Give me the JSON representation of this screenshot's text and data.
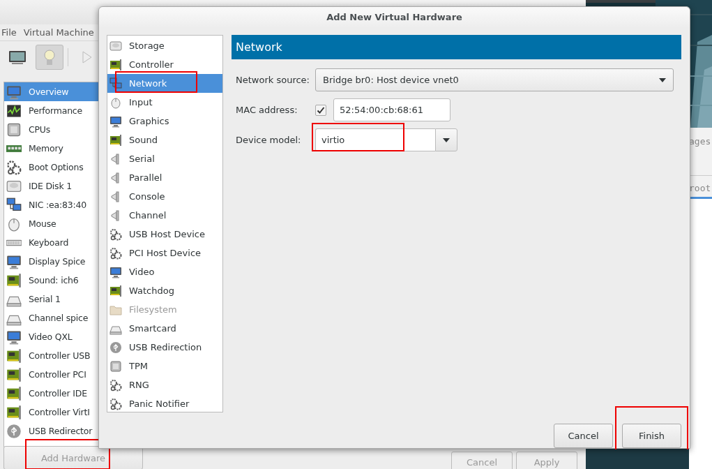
{
  "main_window": {
    "menu": [
      "File",
      "Virtual Machine"
    ],
    "toolbar": [
      {
        "selected": false
      },
      {
        "selected": true
      },
      {
        "selected": false
      }
    ],
    "sidebar": {
      "items": [
        {
          "label": "Overview",
          "selected": true
        },
        {
          "label": "Performance",
          "selected": false
        },
        {
          "label": "CPUs",
          "selected": false
        },
        {
          "label": "Memory",
          "selected": false
        },
        {
          "label": "Boot Options",
          "selected": false
        },
        {
          "label": "IDE Disk 1",
          "selected": false
        },
        {
          "label": "NIC :ea:83:40",
          "selected": false
        },
        {
          "label": "Mouse",
          "selected": false
        },
        {
          "label": "Keyboard",
          "selected": false
        },
        {
          "label": "Display Spice",
          "selected": false
        },
        {
          "label": "Sound: ich6",
          "selected": false
        },
        {
          "label": "Serial 1",
          "selected": false
        },
        {
          "label": "Channel spice",
          "selected": false
        },
        {
          "label": "Video QXL",
          "selected": false
        },
        {
          "label": "Controller USB",
          "selected": false
        },
        {
          "label": "Controller PCI",
          "selected": false
        },
        {
          "label": "Controller IDE",
          "selected": false
        },
        {
          "label": "Controller VirtI",
          "selected": false
        },
        {
          "label": "USB Redirector",
          "selected": false
        }
      ]
    },
    "add_button": {
      "label": "Add Hardware",
      "disabled": true,
      "highlighted": true
    },
    "buttons": [
      {
        "label": "Cancel",
        "disabled": true
      },
      {
        "label": "Apply",
        "disabled": true
      }
    ]
  },
  "side_window": {
    "texts": [
      "ages",
      "root"
    ]
  },
  "dialog": {
    "title": "Add New Virtual Hardware",
    "categories": [
      {
        "label": "Storage",
        "selected": false,
        "disabled": false,
        "highlighted": false
      },
      {
        "label": "Controller",
        "selected": false,
        "disabled": false,
        "highlighted": false
      },
      {
        "label": "Network",
        "selected": true,
        "disabled": false,
        "highlighted": true
      },
      {
        "label": "Input",
        "selected": false,
        "disabled": false,
        "highlighted": false
      },
      {
        "label": "Graphics",
        "selected": false,
        "disabled": false,
        "highlighted": false
      },
      {
        "label": "Sound",
        "selected": false,
        "disabled": false,
        "highlighted": false
      },
      {
        "label": "Serial",
        "selected": false,
        "disabled": false,
        "highlighted": false
      },
      {
        "label": "Parallel",
        "selected": false,
        "disabled": false,
        "highlighted": false
      },
      {
        "label": "Console",
        "selected": false,
        "disabled": false,
        "highlighted": false
      },
      {
        "label": "Channel",
        "selected": false,
        "disabled": false,
        "highlighted": false
      },
      {
        "label": "USB Host Device",
        "selected": false,
        "disabled": false,
        "highlighted": false
      },
      {
        "label": "PCI Host Device",
        "selected": false,
        "disabled": false,
        "highlighted": false
      },
      {
        "label": "Video",
        "selected": false,
        "disabled": false,
        "highlighted": false
      },
      {
        "label": "Watchdog",
        "selected": false,
        "disabled": false,
        "highlighted": false
      },
      {
        "label": "Filesystem",
        "selected": false,
        "disabled": true,
        "highlighted": false
      },
      {
        "label": "Smartcard",
        "selected": false,
        "disabled": false,
        "highlighted": false
      },
      {
        "label": "USB Redirection",
        "selected": false,
        "disabled": false,
        "highlighted": false
      },
      {
        "label": "TPM",
        "selected": false,
        "disabled": false,
        "highlighted": false
      },
      {
        "label": "RNG",
        "selected": false,
        "disabled": false,
        "highlighted": false
      },
      {
        "label": "Panic Notifier",
        "selected": false,
        "disabled": false,
        "highlighted": false
      }
    ],
    "panel": {
      "title": "Network",
      "network_source": {
        "label": "Network source:",
        "value": "Bridge br0: Host device vnet0"
      },
      "mac_address": {
        "label": "MAC address:",
        "checked": true,
        "value": "52:54:00:cb:68:61"
      },
      "device_model": {
        "label": "Device model:",
        "value": "virtio",
        "highlighted": true
      }
    },
    "buttons": [
      {
        "label": "Cancel",
        "highlighted": false
      },
      {
        "label": "Finish",
        "highlighted": true
      }
    ]
  }
}
